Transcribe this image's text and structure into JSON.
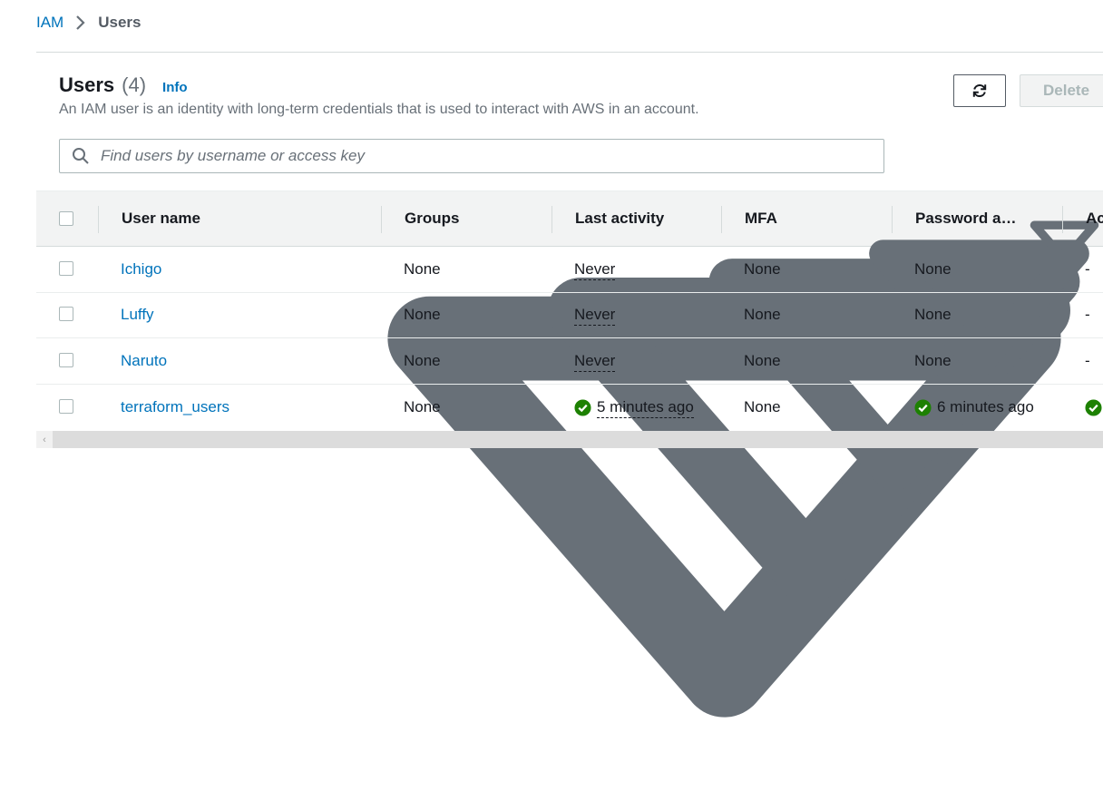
{
  "breadcrumb": {
    "parent": "IAM",
    "current": "Users"
  },
  "header": {
    "title": "Users",
    "count": "(4)",
    "info": "Info",
    "description": "An IAM user is an identity with long-term credentials that is used to interact with AWS in an account.",
    "refresh_icon": "refresh-icon",
    "delete_label": "Delete"
  },
  "search": {
    "placeholder": "Find users by username or access key",
    "value": ""
  },
  "table": {
    "columns": [
      "User name",
      "Groups",
      "Last activity",
      "MFA",
      "Password a…",
      "Ac"
    ],
    "rows": [
      {
        "user_name": "Ichigo",
        "groups": "None",
        "last_activity": "Never",
        "last_activity_ok": false,
        "mfa": "None",
        "password_age": "None",
        "password_ok": false,
        "access": "-"
      },
      {
        "user_name": "Luffy",
        "groups": "None",
        "last_activity": "Never",
        "last_activity_ok": false,
        "mfa": "None",
        "password_age": "None",
        "password_ok": false,
        "access": "-"
      },
      {
        "user_name": "Naruto",
        "groups": "None",
        "last_activity": "Never",
        "last_activity_ok": false,
        "mfa": "None",
        "password_age": "None",
        "password_ok": false,
        "access": "-"
      },
      {
        "user_name": "terraform_users",
        "groups": "None",
        "last_activity": "5 minutes ago",
        "last_activity_ok": true,
        "mfa": "None",
        "password_age": "6 minutes ago",
        "password_ok": true,
        "access": ""
      }
    ]
  },
  "colors": {
    "link": "#0073bb",
    "success": "#1d8102",
    "header_bg": "#f2f3f3"
  }
}
